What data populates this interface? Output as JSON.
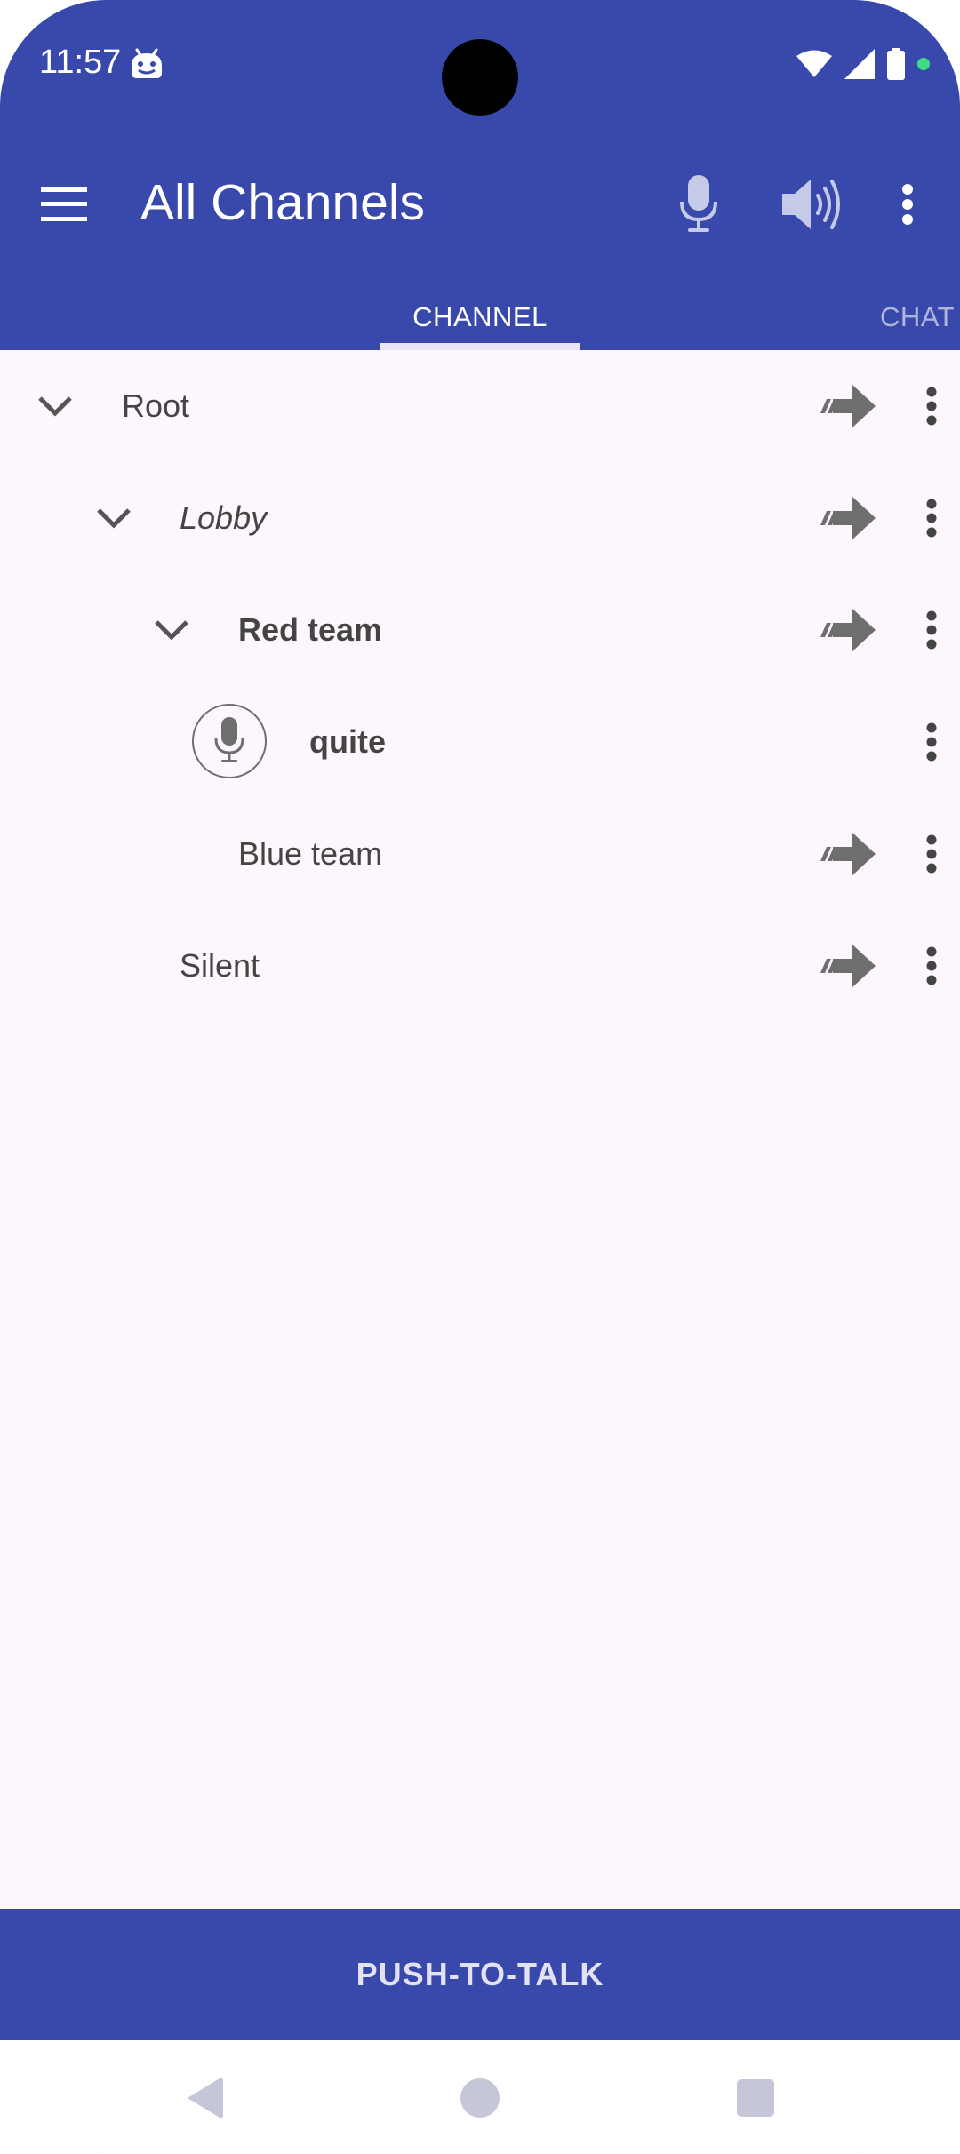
{
  "status_bar": {
    "time": "11:57"
  },
  "app_bar": {
    "title": "All Channels"
  },
  "tabs": [
    {
      "label": "CHANNEL",
      "selected": true
    },
    {
      "label": "CHAT",
      "selected": false
    }
  ],
  "channels": [
    {
      "label": "Root",
      "kind": "channel",
      "expanded": true,
      "style": "normal"
    },
    {
      "label": "Lobby",
      "kind": "channel",
      "expanded": true,
      "style": "italic"
    },
    {
      "label": "Red team",
      "kind": "channel",
      "expanded": true,
      "style": "bold"
    },
    {
      "label": "quite",
      "kind": "user",
      "style": "bold"
    },
    {
      "label": "Blue team",
      "kind": "channel",
      "expanded": false,
      "style": "normal"
    },
    {
      "label": "Silent",
      "kind": "channel",
      "expanded": false,
      "style": "normal"
    }
  ],
  "push_to_talk": {
    "label": "PUSH-TO-TALK"
  },
  "icons": {
    "menu": "hamburger-menu-icon",
    "mic": "microphone-icon",
    "speaker": "speaker-volume-icon",
    "overflow": "more-vertical-icon",
    "join": "join-arrow-icon",
    "expand": "chevron-down-icon"
  },
  "colors": {
    "primary": "#3949ab",
    "background": "#fdf7fd",
    "icon_gray": "#6e6e6e",
    "text_gray": "#444444"
  }
}
